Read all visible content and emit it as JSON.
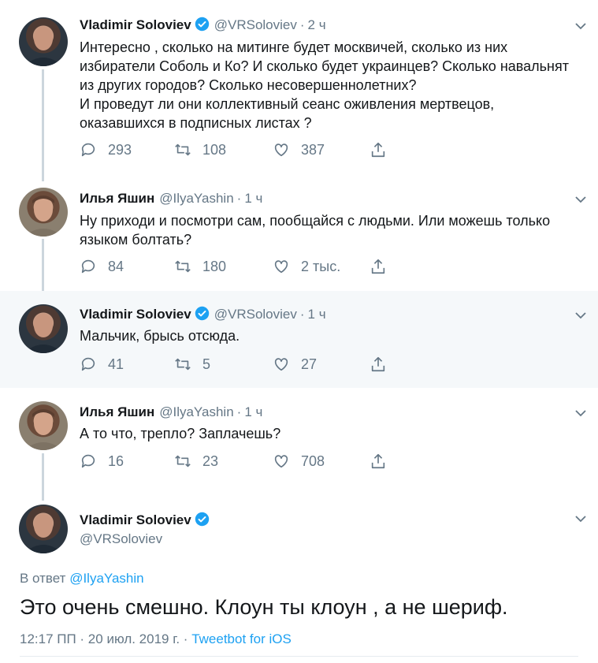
{
  "tweets": [
    {
      "name": "Vladimir Soloviev",
      "handle": "@VRSoloviev",
      "time": "2 ч",
      "verified": true,
      "text": "Интересно , сколько на митинге будет москвичей, сколько из них\nизбиратели Соболь и Ко? И сколько будет украинцев? Сколько навальнят\nиз других городов? Сколько несовершеннолетних?\nИ проведут ли они коллективный сеанс оживления мертвецов,\nоказавшихся в подписных листах ?",
      "replies": "293",
      "retweets": "108",
      "likes": "387"
    },
    {
      "name": "Илья Яшин",
      "handle": "@IlyaYashin",
      "time": "1 ч",
      "verified": false,
      "text": "Ну приходи и посмотри сам, пообщайся с людьми. Или можешь только\nязыком болтать?",
      "replies": "84",
      "retweets": "180",
      "likes": "2 тыс."
    },
    {
      "name": "Vladimir Soloviev",
      "handle": "@VRSoloviev",
      "time": "1 ч",
      "verified": true,
      "text": "Мальчик, брысь отсюда.",
      "replies": "41",
      "retweets": "5",
      "likes": "27"
    },
    {
      "name": "Илья Яшин",
      "handle": "@IlyaYashin",
      "time": "1 ч",
      "verified": false,
      "text": "А то что, трепло? Заплачешь?",
      "replies": "16",
      "retweets": "23",
      "likes": "708"
    }
  ],
  "main": {
    "name": "Vladimir Soloviev",
    "handle": "@VRSoloviev",
    "verified": true,
    "reply_to_prefix": "В ответ",
    "reply_to_handle": "@IlyaYashin",
    "text": "Это очень смешно. Клоун ты клоун , а не шериф.",
    "timestamp": "12:17 ПП · 20 июл. 2019 г. · ",
    "source": "Tweetbot for iOS"
  },
  "icons": {
    "reply": "reply-icon",
    "retweet": "retweet-icon",
    "like": "heart-icon",
    "share": "share-icon",
    "verified": "verified-badge-icon",
    "caret": "chevron-down-icon"
  },
  "colors": {
    "link": "#1da1f2",
    "muted": "#657786",
    "thread_line": "#ccd6dd",
    "highlight_bg": "#f5f8fa"
  }
}
